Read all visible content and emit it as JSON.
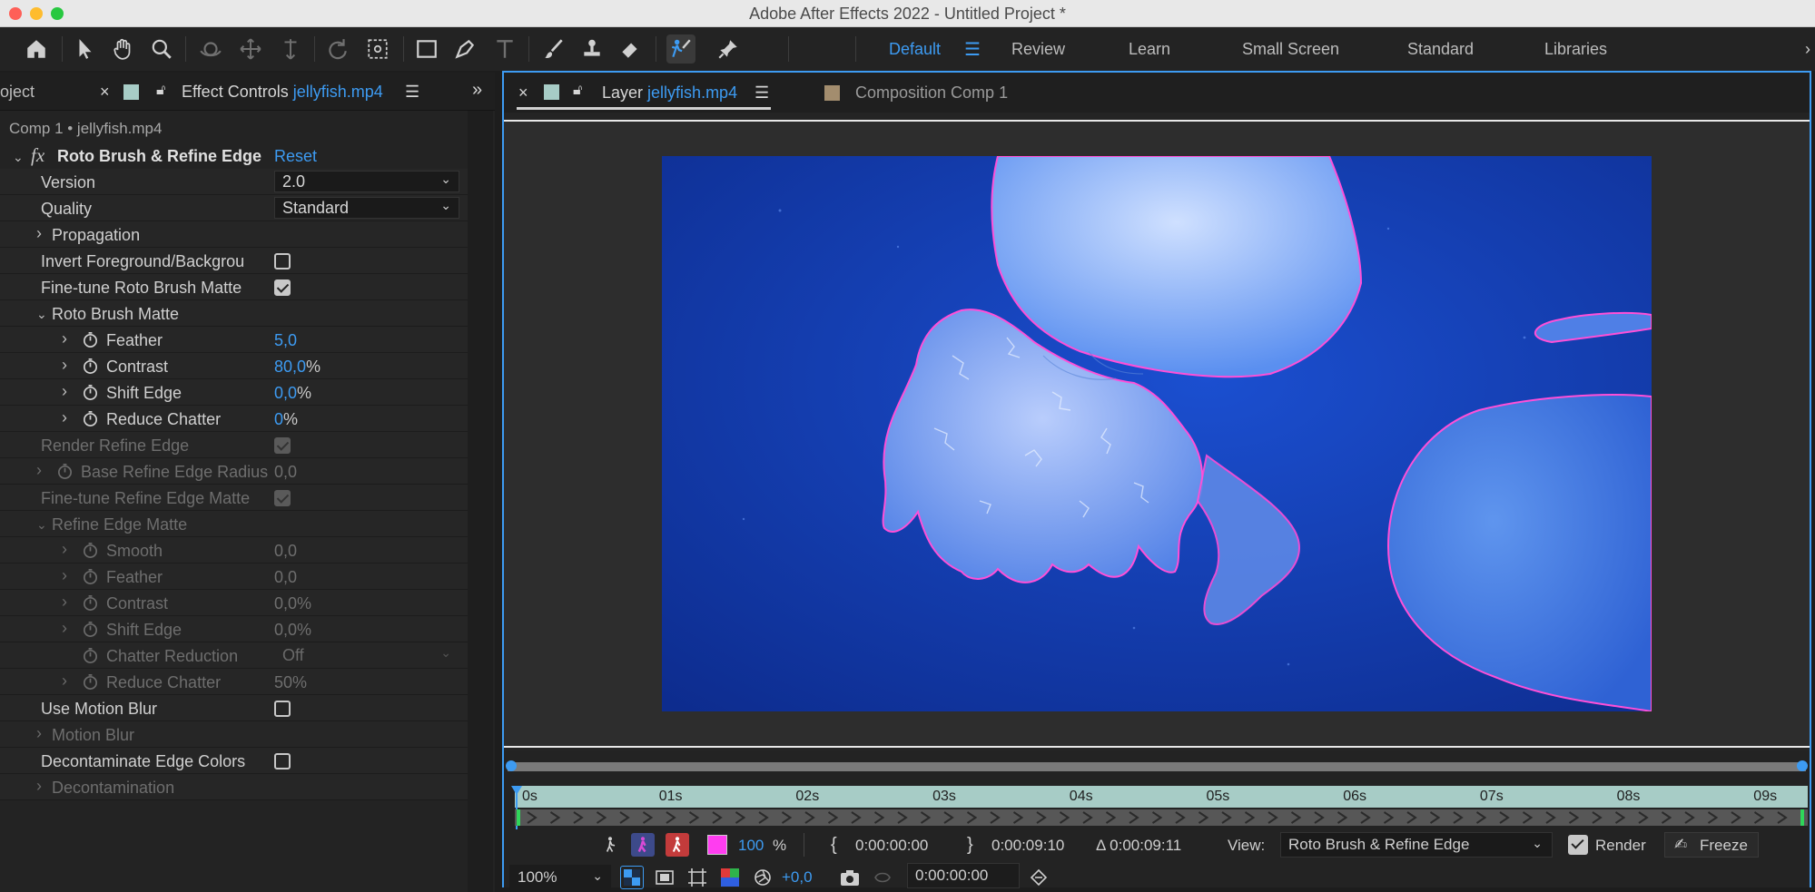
{
  "window": {
    "title": "Adobe After Effects 2022 - Untitled Project *"
  },
  "toolbar": {
    "tools": [
      "home-icon",
      "selection-arrow-icon",
      "hand-icon",
      "zoom-icon",
      "orbit-camera-icon",
      "pan-camera-icon",
      "dolly-camera-icon",
      "rotate-icon",
      "anchor-point-icon",
      "rectangle-icon",
      "pen-icon",
      "type-icon",
      "brush-icon",
      "clone-stamp-icon",
      "eraser-icon",
      "roto-brush-icon",
      "puppet-pin-icon"
    ],
    "workspaces": [
      "Default",
      "Review",
      "Learn",
      "Small Screen",
      "Standard",
      "Libraries"
    ],
    "active_workspace": "Default"
  },
  "effect_panel": {
    "project_tab_label": "oject",
    "tab_label": "Effect Controls",
    "tab_file": "jellyfish.mp4",
    "comp_line": "Comp 1 • jellyfish.mp4",
    "effect_name": "Roto Brush & Refine Edge",
    "reset_label": "Reset",
    "fx_label": "fx",
    "rows": [
      {
        "label": "Version",
        "type": "dropdown",
        "value": "2.0",
        "indent": 0,
        "disabled": false
      },
      {
        "label": "Quality",
        "type": "dropdown",
        "value": "Standard",
        "indent": 0,
        "disabled": false
      },
      {
        "label": "Propagation",
        "type": "group",
        "indent": 0,
        "expanded": false,
        "disabled": false
      },
      {
        "label": "Invert Foreground/Backgrou",
        "type": "checkbox",
        "checked": false,
        "indent": 0,
        "disabled": false
      },
      {
        "label": "Fine-tune Roto Brush Matte",
        "type": "checkbox",
        "checked": true,
        "indent": 0,
        "disabled": false
      },
      {
        "label": "Roto Brush Matte",
        "type": "group",
        "indent": 0,
        "expanded": true,
        "disabled": false
      },
      {
        "label": "Feather",
        "type": "value",
        "value": "5,0",
        "unit": "",
        "indent": 1,
        "stopwatch": true,
        "disabled": false
      },
      {
        "label": "Contrast",
        "type": "value",
        "value": "80,0",
        "unit": "%",
        "indent": 1,
        "stopwatch": true,
        "disabled": false
      },
      {
        "label": "Shift Edge",
        "type": "value",
        "value": "0,0",
        "unit": "%",
        "indent": 1,
        "stopwatch": true,
        "disabled": false
      },
      {
        "label": "Reduce Chatter",
        "type": "value",
        "value": "0",
        "unit": "%",
        "indent": 1,
        "stopwatch": true,
        "disabled": false
      },
      {
        "label": "Render Refine Edge",
        "type": "checkbox",
        "checked": true,
        "indent": 0,
        "disabled": true
      },
      {
        "label": "Base Refine Edge Radius",
        "type": "value",
        "value": "0,0",
        "unit": "",
        "indent": 0,
        "twirl": true,
        "stopwatch": true,
        "disabled": true
      },
      {
        "label": "Fine-tune Refine Edge Matte",
        "type": "checkbox",
        "checked": true,
        "indent": 0,
        "disabled": true
      },
      {
        "label": "Refine Edge Matte",
        "type": "group",
        "indent": 0,
        "expanded": true,
        "disabled": true
      },
      {
        "label": "Smooth",
        "type": "value",
        "value": "0,0",
        "unit": "",
        "indent": 1,
        "stopwatch": true,
        "disabled": true
      },
      {
        "label": "Feather",
        "type": "value",
        "value": "0,0",
        "unit": "",
        "indent": 1,
        "stopwatch": true,
        "disabled": true
      },
      {
        "label": "Contrast",
        "type": "value",
        "value": "0,0%",
        "unit": "",
        "indent": 1,
        "stopwatch": true,
        "disabled": true
      },
      {
        "label": "Shift Edge",
        "type": "value",
        "value": "0,0%",
        "unit": "",
        "indent": 1,
        "stopwatch": true,
        "disabled": true
      },
      {
        "label": "Chatter Reduction",
        "type": "dropdown",
        "value": "Off",
        "indent": 1,
        "stopwatch": true,
        "notwirl": true,
        "disabled": true
      },
      {
        "label": "Reduce Chatter",
        "type": "value",
        "value": "50%",
        "unit": "",
        "indent": 1,
        "stopwatch": true,
        "disabled": true
      },
      {
        "label": "Use Motion Blur",
        "type": "checkbox",
        "checked": false,
        "indent": 0,
        "disabled": false
      },
      {
        "label": "Motion Blur",
        "type": "group",
        "indent": 0,
        "expanded": false,
        "disabled": true
      },
      {
        "label": "Decontaminate Edge Colors",
        "type": "checkbox",
        "checked": false,
        "indent": 0,
        "disabled": false
      },
      {
        "label": "Decontamination",
        "type": "group",
        "indent": 0,
        "expanded": false,
        "disabled": true
      }
    ]
  },
  "viewer_panel": {
    "layer_tab_label": "Layer",
    "layer_tab_file": "jellyfish.mp4",
    "comp_tab_label": "Composition Comp 1",
    "time_ticks": [
      "0s",
      "01s",
      "02s",
      "03s",
      "04s",
      "05s",
      "06s",
      "07s",
      "08s",
      "09s"
    ],
    "controls": {
      "matte_opacity": "100",
      "percent": "%",
      "in_point": "0:00:00:00",
      "out_point": "0:00:09:10",
      "duration": "Δ 0:00:09:11",
      "view_label": "View:",
      "view_value": "Roto Brush & Refine Edge",
      "render_label": "Render",
      "freeze_label": "Freeze",
      "zoom": "100%",
      "exposure": "+0,0",
      "current_time": "0:00:00:00"
    }
  },
  "colors": {
    "accent": "#3d9bf2",
    "outline": "#ff4fd8",
    "layer_label": "#a7ccc6",
    "comp_label": "#a38d6e"
  }
}
